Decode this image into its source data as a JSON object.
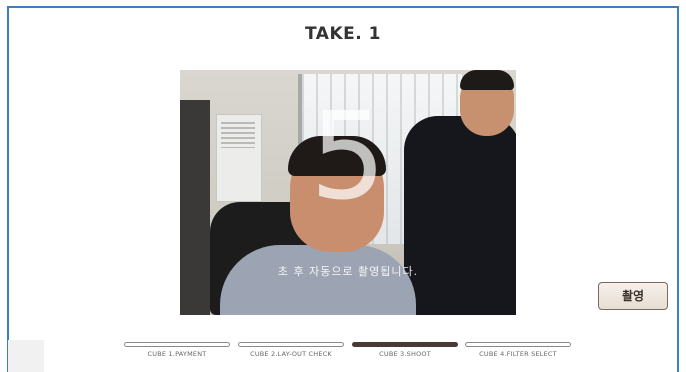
{
  "title": "TAKE. 1",
  "camera": {
    "countdown": "5",
    "caption": "초 후 자동으로 촬영됩니다."
  },
  "shoot_button": {
    "label": "촬영"
  },
  "steps": [
    {
      "label": "CUBE 1.PAYMENT",
      "active": false
    },
    {
      "label": "CUBE 2.LAY-OUT CHECK",
      "active": false
    },
    {
      "label": "CUBE 3.SHOOT",
      "active": true
    },
    {
      "label": "CUBE 4.FILTER SELECT",
      "active": false
    }
  ],
  "colors": {
    "frame_border": "#3c7fc0",
    "active_step": "#4a3a33",
    "button_border": "#7a6a60"
  }
}
